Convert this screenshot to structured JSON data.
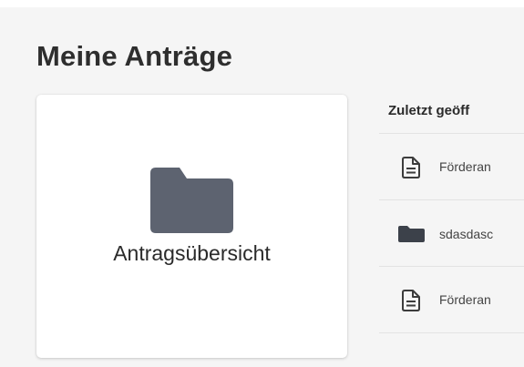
{
  "page": {
    "title": "Meine Anträge"
  },
  "card": {
    "label": "Antragsübersicht",
    "icon": "folder-icon"
  },
  "recent": {
    "header": "Zuletzt geöff",
    "rows": [
      {
        "icon": "document-icon",
        "label": "Förderan"
      },
      {
        "icon": "folder-icon",
        "label": "sdasdasc"
      },
      {
        "icon": "document-icon",
        "label": "Förderan"
      }
    ]
  },
  "colors": {
    "background": "#f5f5f5",
    "card": "#ffffff",
    "icon": "#5d6370",
    "divider": "#e3e3e3"
  }
}
